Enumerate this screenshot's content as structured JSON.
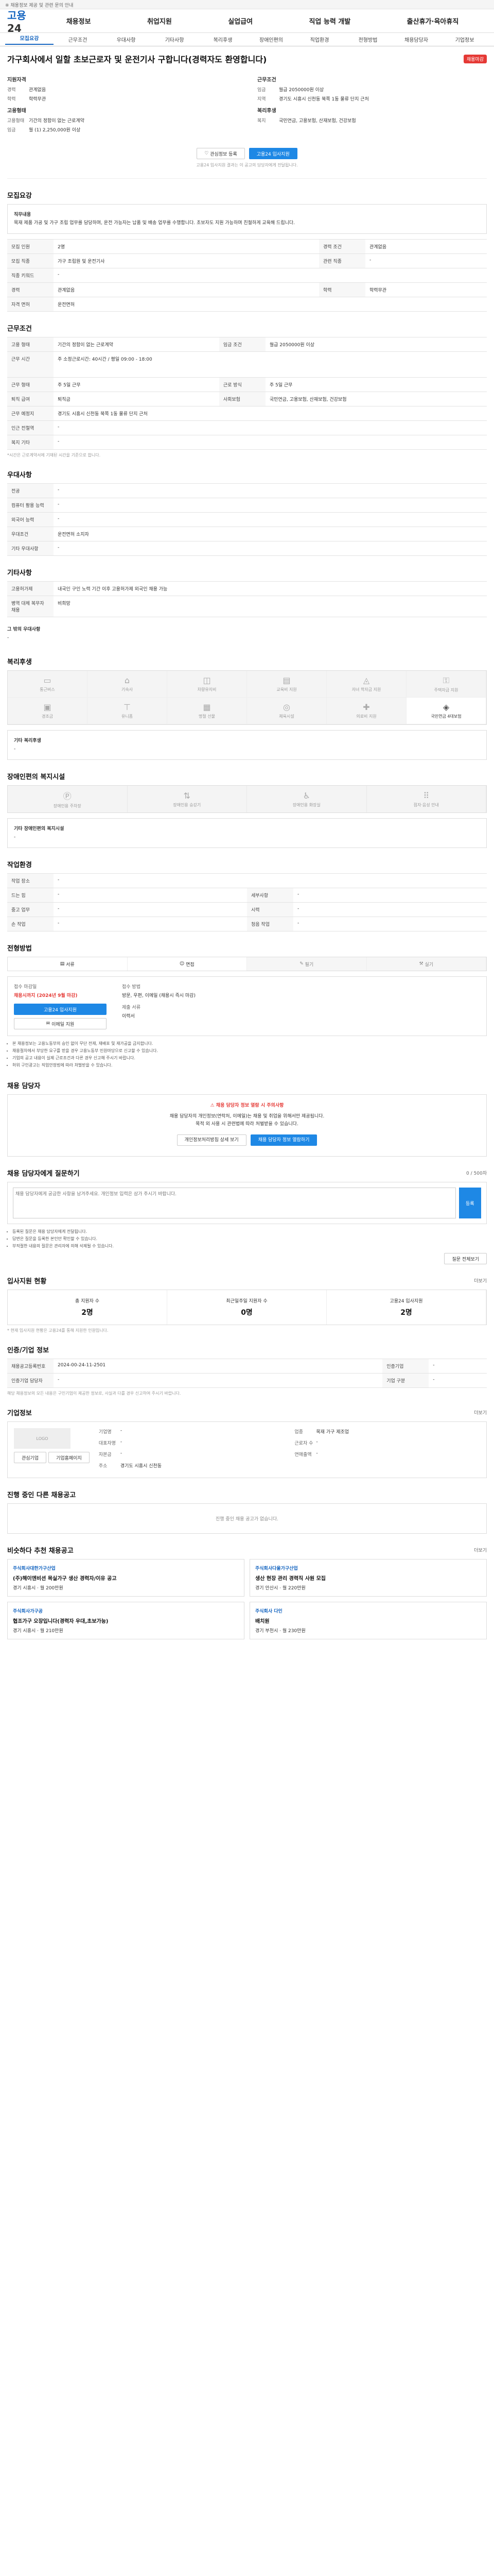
{
  "topbar": {
    "text": "※ 채용정보 제공 및 관련 문의 안내"
  },
  "gnb": {
    "logo_a": "고용",
    "logo_b": "24",
    "menu": [
      "채용정보",
      "취업지원",
      "실업급여",
      "직업 능력 개발",
      "출산휴가·육아휴직"
    ]
  },
  "subtabs": [
    "모집요강",
    "근무조건",
    "우대사항",
    "기타사항",
    "복리후생",
    "장애인편의",
    "직업환경",
    "전형방법",
    "채용담당자",
    "기업정보"
  ],
  "job": {
    "title": "가구회사에서 일할 초보근로자 및 운전기사 구합니다(경력자도 환영합니다)",
    "badge": "채용마감",
    "left_head": "지원자격",
    "left": [
      {
        "k": "경력",
        "v": "관계없음"
      },
      {
        "k": "학력",
        "v": "학력무관"
      }
    ],
    "left_head2": "고용형태",
    "left2": [
      {
        "k": "고용형태",
        "v": "기간의 정함이 없는 근로계약"
      },
      {
        "k": "임금",
        "v": "월 (1) 2,250,000원 이상"
      }
    ],
    "right_head": "근무조건",
    "right": [
      {
        "k": "임금",
        "v": "월급 2050000원 이상"
      },
      {
        "k": "지역",
        "v": "경기도 시흥시 신천동 북쪽 1동 물류 단지 근처"
      }
    ],
    "right_head2": "복리후생",
    "right2": [
      {
        "k": "복지",
        "v": "국민연금, 고용보험, 산재보험, 건강보험"
      }
    ],
    "btn_scrap": "관심정보 등록",
    "btn_apply": "고용24 입사지원",
    "note": "고용24 입사지원 결과는 이 공고의 담당자에게 전달됩니다."
  },
  "sec_recruit": {
    "title": "모집요강",
    "desc_head": "직무내용",
    "desc": "목재 제품 가공 및 가구 조립 업무를 담당하며, 운전 가능자는 납품 및 배송 업무를 수행합니다. 초보자도 지원 가능하며 친절하게 교육해 드립니다.",
    "rows": [
      {
        "k": "모집 인원",
        "v": "2명",
        "k2": "경력 조건",
        "v2": "관계없음"
      },
      {
        "k": "모집 직종",
        "v": "가구 조립원 및 운전기사",
        "k2": "관련 직종",
        "v2": "-"
      },
      {
        "k": "직종 키워드",
        "v": "-",
        "k2": "",
        "v2": ""
      },
      {
        "k": "경력",
        "v": "관계없음",
        "k2": "학력",
        "v2": "학력무관"
      },
      {
        "k": "자격 면허",
        "v": "운전면허"
      }
    ]
  },
  "sec_work": {
    "title": "근무조건",
    "rows": [
      {
        "k": "고용 형태",
        "v": "기간의 정함이 없는 근로계약",
        "k2": "임금 조건",
        "v2": "월급 2050000원 이상"
      },
      {
        "k": "근무 시간",
        "v": "주 소정근로시간: 40시간 / 평일 09:00 - 18:00",
        "k2": "",
        "v2": ""
      },
      {
        "k": "근무 형태",
        "v": "주 5일 근무",
        "k2": "근로 방식",
        "v2": "주 5일 근무"
      },
      {
        "k": "퇴직 급여",
        "v": "퇴직금",
        "k2": "사회보험",
        "v2": "국민연금, 고용보험, 산재보험, 건강보험"
      },
      {
        "k": "근무 예정지",
        "v": "경기도 시흥시 신천동 북쪽 1동 물류 단지 근처",
        "k2": "",
        "v2": ""
      },
      {
        "k": "인근 전철역",
        "v": "-"
      },
      {
        "k": "복지 기타",
        "v": "-"
      }
    ],
    "note": "*시간은 근로계약서에 기재된 시간을 기준으로 합니다."
  },
  "sec_pref": {
    "title": "우대사항",
    "rows": [
      {
        "k": "전공",
        "v": "-"
      },
      {
        "k": "컴퓨터 활용 능력",
        "v": "-"
      },
      {
        "k": "외국어 능력",
        "v": "-"
      },
      {
        "k": "우대조건",
        "v": "운전면허 소지자"
      },
      {
        "k": "기타 우대사항",
        "v": "-"
      }
    ]
  },
  "sec_etc": {
    "title": "기타사항",
    "rows": [
      {
        "k": "고용허가제",
        "v": "내국인 구인 노력 기간 이후 고용허가제 외국인 채용 가능"
      },
      {
        "k": "병역 대체 복무자 채용",
        "v": "비희망"
      }
    ],
    "sub_head": "그 밖의 우대사항",
    "sub_val": "-"
  },
  "sec_welfare": {
    "title": "복리후생",
    "items": [
      "통근버스",
      "기숙사",
      "차량유지비",
      "교육비 지원",
      "자녀 학자금 지원",
      "주택자금 지원",
      "경조금",
      "유니폼",
      "명절 선물",
      "체육시설",
      "의료비 지원",
      "국민연금 4대보험"
    ],
    "active": [
      11
    ],
    "sub_head": "기타 복리후생",
    "sub_val": "-"
  },
  "sec_disabled": {
    "title": "장애인편의 복지시설",
    "items": [
      "장애인용 주차장",
      "장애인용 승강기",
      "장애인용 화장실",
      "점자·음성 안내"
    ],
    "sub_head": "기타 장애인편의 복지시설",
    "sub_val": "-"
  },
  "sec_env": {
    "title": "작업환경",
    "rows": [
      {
        "k": "작업 장소",
        "v": "-",
        "k2": "",
        "v2": ""
      },
      {
        "k": "드는 힘",
        "v": "-",
        "k2": "세부사항",
        "v2": "-"
      },
      {
        "k": "중고 업무",
        "v": "-",
        "k2": "시력",
        "v2": "-"
      },
      {
        "k": "손 작업",
        "v": "-",
        "k2": "청음 작업",
        "v2": "-"
      }
    ]
  },
  "sec_select": {
    "title": "전형방법",
    "methods": [
      "서류",
      "면접",
      "필기",
      "실기"
    ],
    "active_methods": [
      0,
      1
    ],
    "apply_head": "접수 마감일",
    "apply_date": "채용시까지 (2024년 9월 마감)",
    "apply_btn": "고용24 입사지원",
    "apply_btn2": "이메일 지원",
    "docs_head": "접수 방법",
    "docs": "방문, 우편, 이메일 (채용시 즉시 마감)",
    "docs_head2": "제출 서류",
    "docs2": "이력서",
    "notes": [
      "본 채용정보는 고용노동부의 승인 없이 무단 전재, 재배포 및 재가공을 금지합니다.",
      "채용절차에서 부당한 요구를 받을 경우 고용노동부 민원마당으로 신고할 수 있습니다.",
      "기업의 공고 내용이 실제 근로조건과 다른 경우 신고해 주시기 바랍니다.",
      "허위 구인광고는 직업안정법에 따라 처벌받을 수 있습니다."
    ]
  },
  "sec_contact": {
    "title": "채용 담당자",
    "alert_head": "채용 담당자 정보 열람 시 주의사항",
    "alert_body": "채용 담당자의 개인정보(연락처, 이메일)는 채용 및 취업을 위해서만 제공됩니다.",
    "alert_body2": "목적 외 사용 시 관련법에 따라 처벌받을 수 있습니다.",
    "btn_a": "개인정보처리방침 상세 보기",
    "btn_b": "채용 담당자 정보 열람하기"
  },
  "sec_qa": {
    "title": "채용 담당자에게 질문하기",
    "limit": "0 / 500자",
    "placeholder": "채용 담당자에게 궁금한 사항을 남겨주세요. 개인정보 입력은 삼가 주시기 바랍니다.",
    "btn": "등록",
    "notes": [
      "등록된 질문은 채용 담당자에게 전달됩니다.",
      "답변은 질문을 등록한 본인만 확인할 수 있습니다.",
      "부적절한 내용의 질문은 관리자에 의해 삭제될 수 있습니다."
    ],
    "btn_all": "질문 전체보기"
  },
  "sec_stats": {
    "title": "입사지원 현황",
    "more": "더보기",
    "items": [
      {
        "label": "총 지원자 수",
        "value": "2명"
      },
      {
        "label": "최근일주일 지원자 수",
        "value": "0명"
      },
      {
        "label": "고용24 입사지원",
        "value": "2명"
      }
    ],
    "note": "* 현재 입사지원 현황은 고용24를 통해 지원한 인원입니다."
  },
  "sec_info": {
    "title": "인증/기업 정보",
    "rows": [
      {
        "k": "채용공고등록번호",
        "v": "2024-00-24-11-2501",
        "k2": "인증기업",
        "v2": "-"
      },
      {
        "k": "인증기업 담당자",
        "v": "-",
        "k2": "기업 구분",
        "v2": "-"
      }
    ],
    "note": "해당 채용정보의 모든 내용은 구인기업이 제공한 정보로, 사실과 다를 경우 신고하여 주시기 바랍니다."
  },
  "sec_corp": {
    "title": "기업정보",
    "more": "더보기",
    "logo": "LOGO",
    "rows": [
      {
        "k": "기업명",
        "v": "-"
      },
      {
        "k": "업종",
        "v": "목재 가구 제조업"
      },
      {
        "k": "대표자명",
        "v": "-"
      },
      {
        "k": "근로자 수",
        "v": "-"
      },
      {
        "k": "자본금",
        "v": "-"
      },
      {
        "k": "연매출액",
        "v": "-"
      },
      {
        "k": "주소",
        "v": "경기도 시흥시 신천동"
      }
    ],
    "btn_a": "관심기업",
    "btn_b": "기업홈페이지"
  },
  "sec_other": {
    "title": "진행 중인 다른 채용공고",
    "empty": "진행 중인 채용 공고가 없습니다."
  },
  "sec_similar": {
    "title": "비슷하다 추천 채용공고",
    "more": "더보기",
    "cards": [
      {
        "corp": "주식회사대한가구산업",
        "title": "(주)해이엔비션 목실가구 생산 경력자/이유 공고",
        "info": "경기 시흥시 · 월 200만원"
      },
      {
        "corp": "주식회사다울가구산업",
        "title": "생산 현장 관리 경력직 사원 모집",
        "info": "경기 안산시 · 월 220만원"
      },
      {
        "corp": "주식회사가구공",
        "title": "협조가구 오장입니다(경력자 우대,초보가능)",
        "info": "경기 시흥시 · 월 210만원"
      },
      {
        "corp": "주식회사 다인",
        "title": "배치원",
        "info": "경기 부천시 · 월 230만원"
      }
    ]
  }
}
